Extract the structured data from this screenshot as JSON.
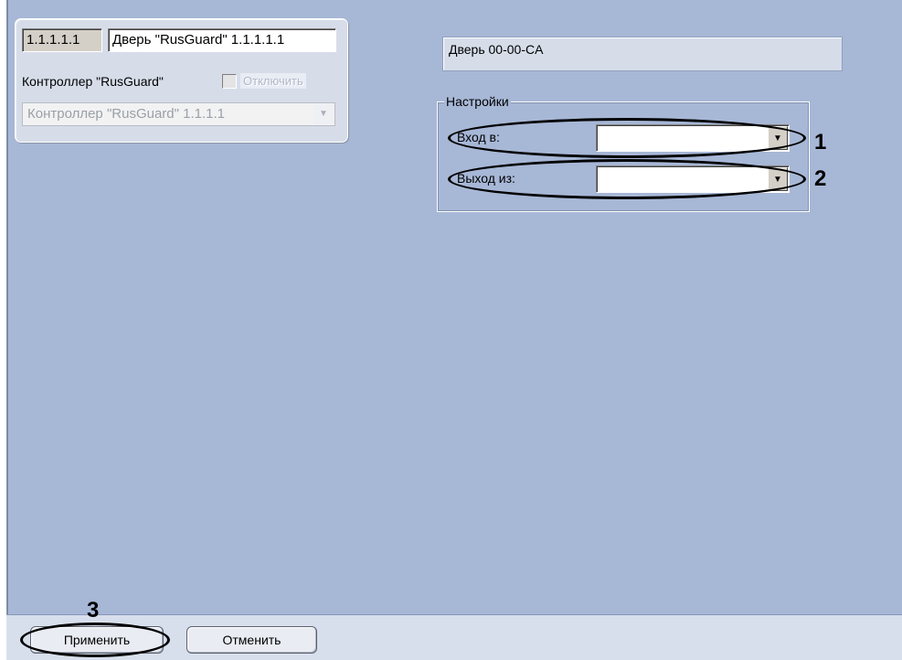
{
  "object_panel": {
    "id_value": "1.1.1.1.1",
    "name_value": "Дверь \"RusGuard\" 1.1.1.1.1",
    "parent_label": "Контроллер \"RusGuard\"",
    "disable_label": "Отключить",
    "parent_selected": "Контроллер \"RusGuard\" 1.1.1.1"
  },
  "settings": {
    "door_name": "Дверь 00-00-CA",
    "group_title": "Настройки",
    "entry_label": "Вход в:",
    "entry_value": "",
    "exit_label": "Выход из:",
    "exit_value": ""
  },
  "callouts": {
    "n1": "1",
    "n2": "2",
    "n3": "3"
  },
  "footer": {
    "apply_label": "Применить",
    "cancel_label": "Отменить"
  },
  "icons": {
    "dropdown": "chevron-down-icon"
  }
}
